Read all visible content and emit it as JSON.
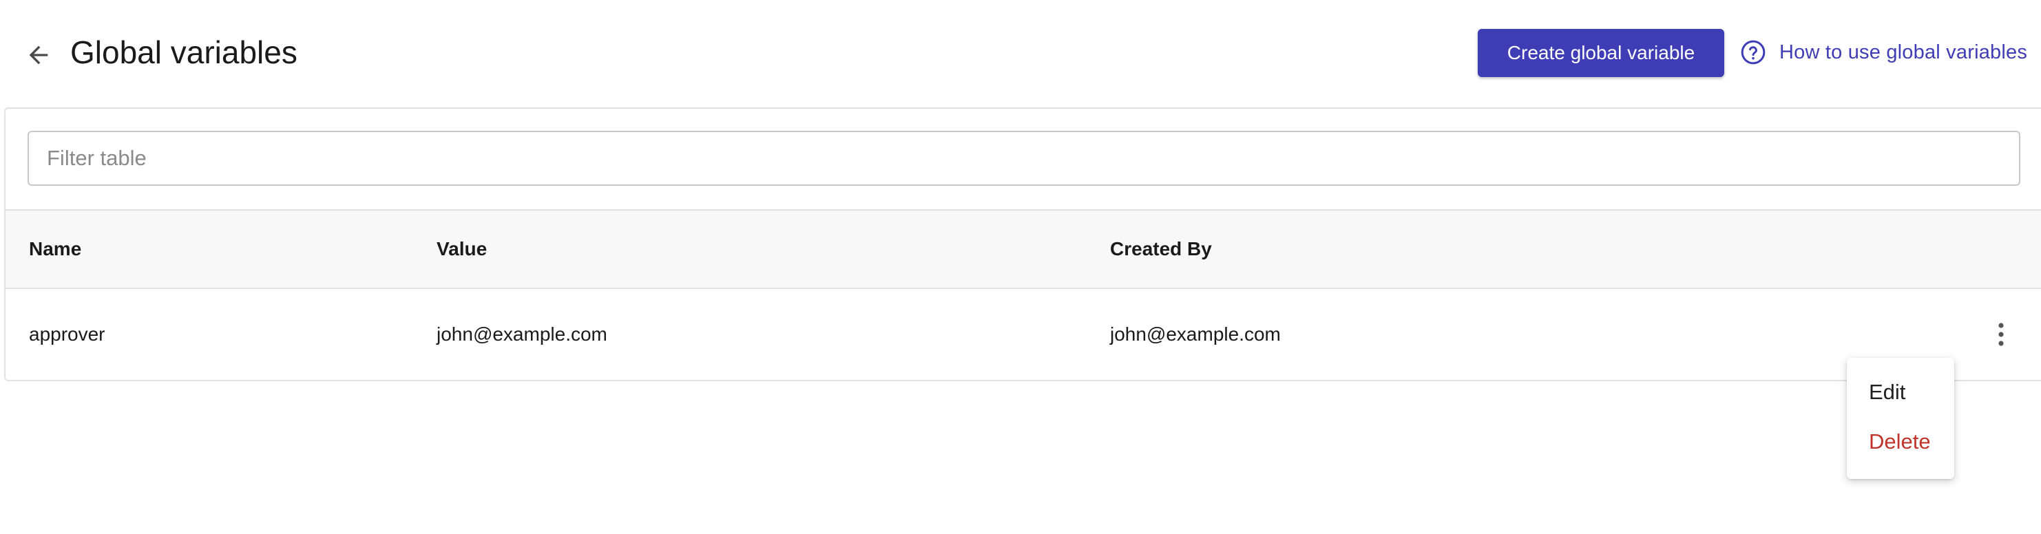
{
  "header": {
    "title": "Global variables",
    "create_button_label": "Create global variable",
    "help_link_label": "How to use global variables"
  },
  "filter": {
    "placeholder": "Filter table",
    "value": ""
  },
  "table": {
    "columns": [
      "Name",
      "Value",
      "Created By"
    ],
    "rows": [
      {
        "name": "approver",
        "value": "john@example.com",
        "created_by": "john@example.com"
      }
    ]
  },
  "row_menu": {
    "items": [
      {
        "label": "Edit"
      },
      {
        "label": "Delete"
      }
    ]
  },
  "icons": {
    "back": "arrow-left-icon",
    "help": "help-circle-icon",
    "row_actions": "more-vertical-icon"
  },
  "colors": {
    "primary": "#3f3db5",
    "danger": "#c0352b",
    "header_bg": "#f8f8f8",
    "border": "#e2e2e2"
  }
}
